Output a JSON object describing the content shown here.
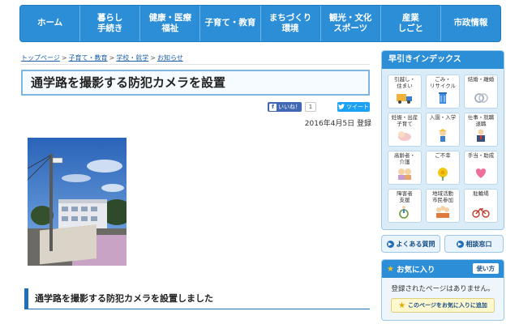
{
  "nav": {
    "items": [
      "ホーム",
      "暮らし\n手続き",
      "健康・医療\n福祉",
      "子育て・教育",
      "まちづくり\n環境",
      "観光・文化\nスポーツ",
      "産業\nしごと",
      "市政情報"
    ]
  },
  "breadcrumb": {
    "items": [
      "トップページ",
      "子育て・教育",
      "学校・就学",
      "お知らせ"
    ],
    "separator": ">"
  },
  "page": {
    "title": "通学路を撮影する防犯カメラを設置",
    "date": "2016年4月5日 登録",
    "section_heading": "通学路を撮影する防犯カメラを設置しました"
  },
  "social": {
    "fb_label": "いいね！",
    "fb_count": "1",
    "tw_label": "ツイート"
  },
  "sidebar": {
    "index_title": "早引きインデックス",
    "index_items": [
      {
        "label": "引越し・\n住まい",
        "icon": "moving-truck-icon"
      },
      {
        "label": "ごみ・\nリサイクル",
        "icon": "trash-bin-icon"
      },
      {
        "label": "結婚・離婚",
        "icon": "rings-icon"
      },
      {
        "label": "妊娠・出産\n子育て",
        "icon": "baby-icon"
      },
      {
        "label": "入園・入学",
        "icon": "school-kid-icon"
      },
      {
        "label": "仕事・就職\n退職",
        "icon": "worker-icon"
      },
      {
        "label": "高齢者・\n介護",
        "icon": "elderly-icon"
      },
      {
        "label": "ご不幸",
        "icon": "chrysanthemum-icon"
      },
      {
        "label": "手当・助成",
        "icon": "heart-hands-icon"
      },
      {
        "label": "障害者\n支援",
        "icon": "wheelchair-icon"
      },
      {
        "label": "地域活動\n市民参加",
        "icon": "community-icon"
      },
      {
        "label": "駐輪場",
        "icon": "bicycle-icon"
      }
    ],
    "faq_label": "よくある質問",
    "consult_label": "相談窓口",
    "fav_title": "お気に入り",
    "howto_label": "使い方",
    "fav_message": "登録されたページはありません。",
    "fav_add_label": "このページをお気に入りに追加"
  },
  "colors": {
    "nav_blue": "#2b8ed6",
    "accent_dark": "#1e6fb8",
    "sidebar_bg": "#d9ecf8"
  }
}
